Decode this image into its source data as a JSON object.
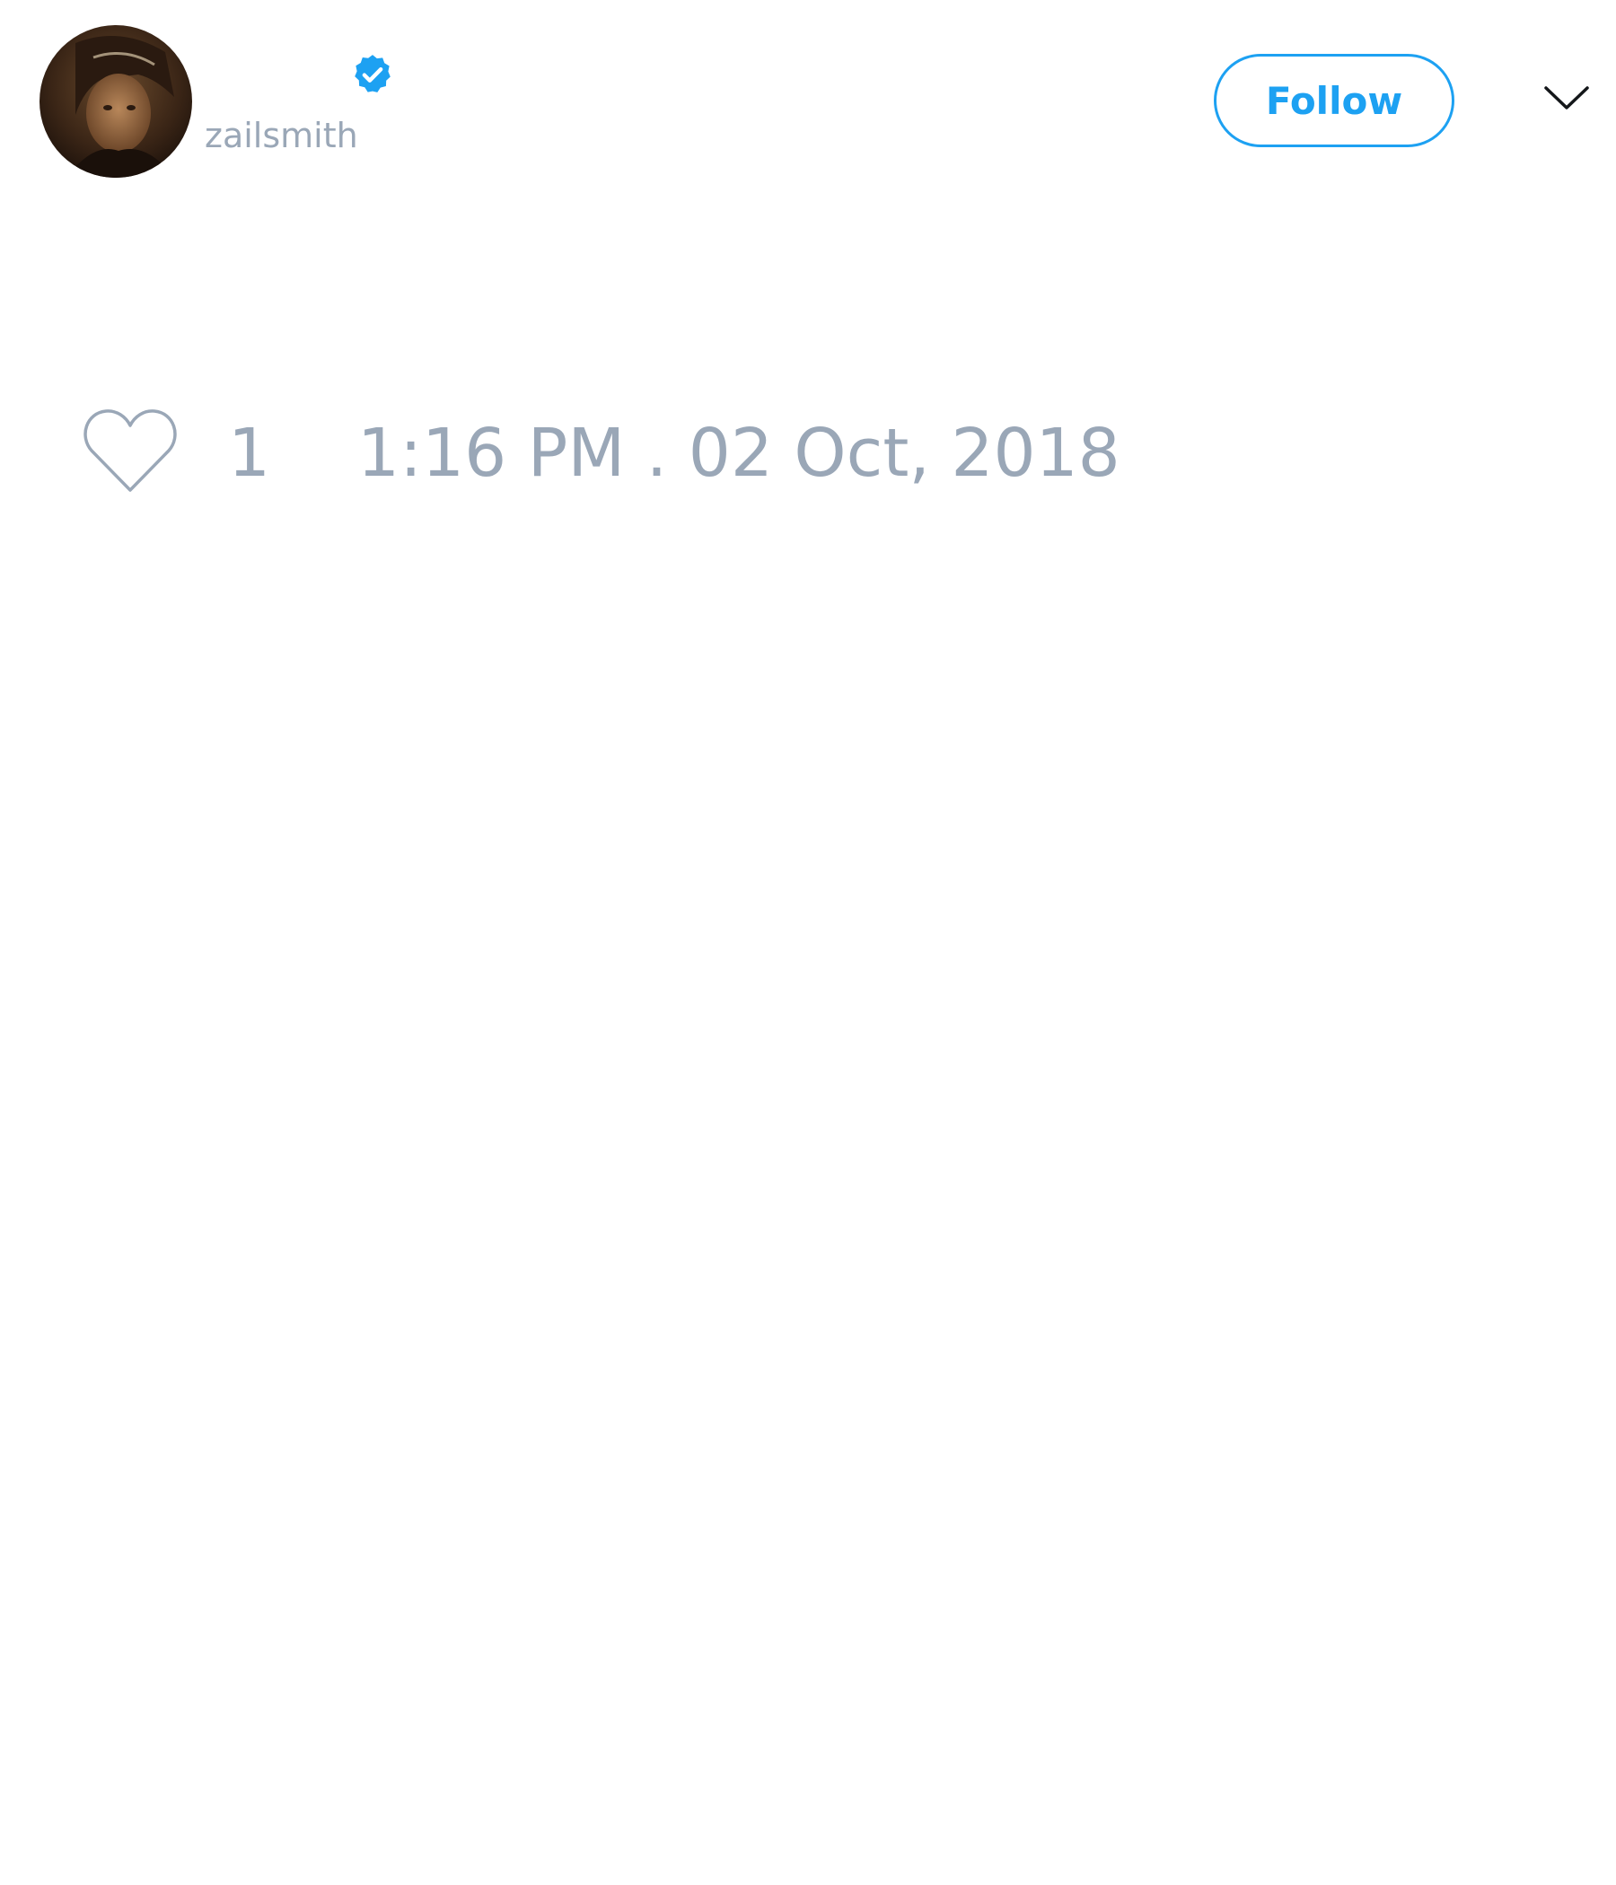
{
  "tweet": {
    "author": {
      "display_name": "",
      "username": "zailsmith",
      "verified": true,
      "avatar_icon": "person-portrait-avatar"
    },
    "follow_label": "Follow",
    "menu_icon": "chevron-down-icon",
    "like_icon": "heart-outline-icon",
    "like_count": "1",
    "timestamp": "1:16 PM . 02 Oct, 2018"
  },
  "colors": {
    "accent": "#1da1f2",
    "muted_text": "#9aa7b7",
    "background": "#ffffff"
  }
}
